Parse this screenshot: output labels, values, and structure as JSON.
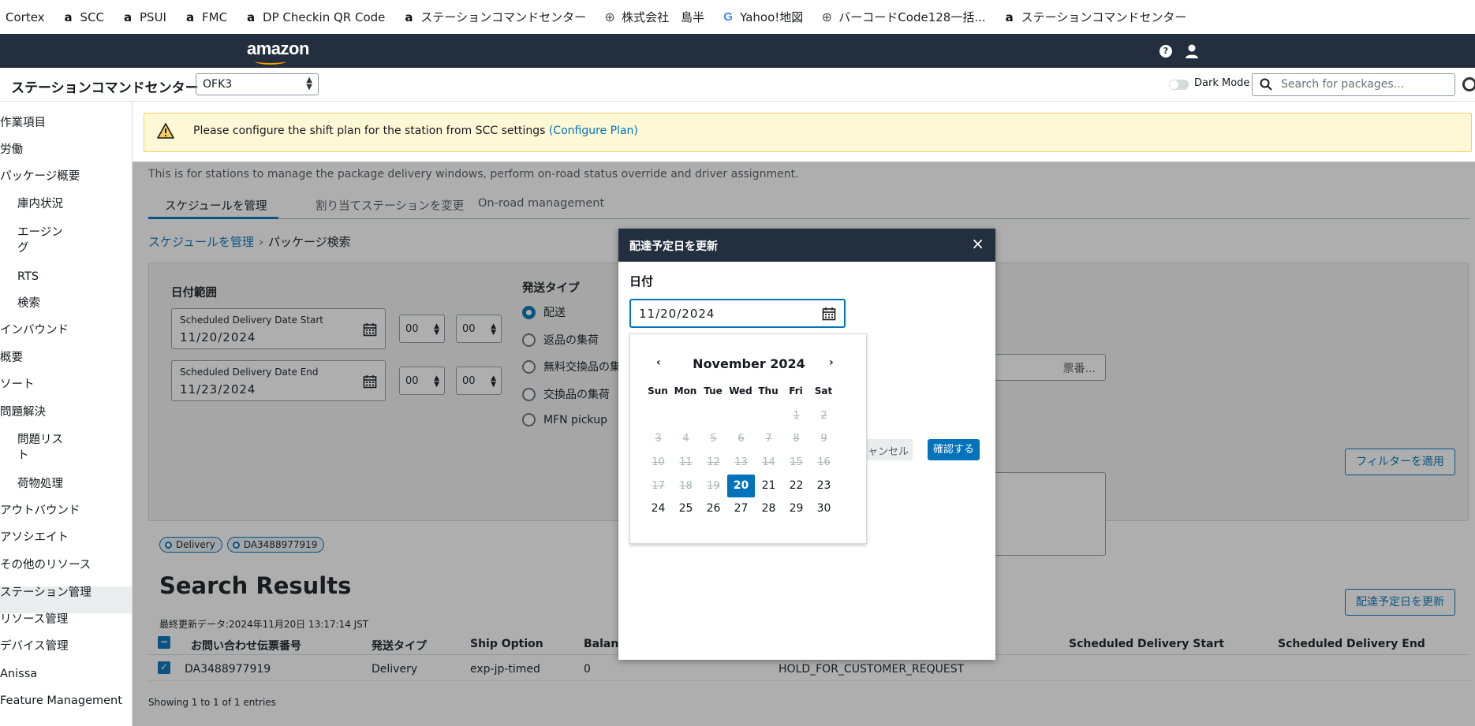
{
  "bookmarks": [
    {
      "label": "Cortex",
      "icon": "none"
    },
    {
      "label": "SCC",
      "icon": "amazon-icon"
    },
    {
      "label": "PSUI",
      "icon": "amazon-icon"
    },
    {
      "label": "FMC",
      "icon": "amazon-icon"
    },
    {
      "label": "DP Checkin QR Code",
      "icon": "amazon-icon"
    },
    {
      "label": "ステーションコマンドセンター",
      "icon": "amazon-icon"
    },
    {
      "label": "株式会社　島半",
      "icon": "globe-icon"
    },
    {
      "label": "Yahoo!地図",
      "icon": "google-icon"
    },
    {
      "label": "バーコードCode128一括...",
      "icon": "globe-icon"
    },
    {
      "label": "ステーションコマンドセンター",
      "icon": "amazon-icon"
    }
  ],
  "topbar": {
    "logo": "amazon",
    "help_icon_glyph": "?"
  },
  "header": {
    "title": "ステーションコマンドセンター",
    "station": "OFK3",
    "dark_mode_label": "Dark Mode",
    "search_placeholder": "Search for packages..."
  },
  "sidebar": {
    "items": [
      {
        "label": "作業項目",
        "sub": false
      },
      {
        "label": "労働",
        "sub": false
      },
      {
        "label": "パッケージ概要",
        "sub": false
      },
      {
        "label": "庫内状況",
        "sub": true
      },
      {
        "label": "エージン\nグ",
        "sub": true
      },
      {
        "label": "RTS",
        "sub": true
      },
      {
        "label": "検索",
        "sub": true
      },
      {
        "label": "インバウンド",
        "sub": false
      },
      {
        "label": "概要",
        "sub": false
      },
      {
        "label": "ソート",
        "sub": false
      },
      {
        "label": "問題解決",
        "sub": false
      },
      {
        "label": "問題リス\nト",
        "sub": true
      },
      {
        "label": "荷物処理",
        "sub": true
      },
      {
        "label": "アウトバウンド",
        "sub": false
      },
      {
        "label": "アソシエイト",
        "sub": false
      },
      {
        "label": "その他のリソース",
        "sub": false
      },
      {
        "label": "ステーション管理",
        "sub": false
      },
      {
        "label": "リソース管理",
        "sub": false
      },
      {
        "label": "デバイス管理",
        "sub": false
      },
      {
        "label": "Anissa",
        "sub": false
      },
      {
        "label": "Feature Management",
        "sub": false
      }
    ],
    "active": "荷物処理"
  },
  "warning": {
    "text": "Please configure the shift plan for the station from SCC settings ",
    "link": "(Configure Plan)"
  },
  "page": {
    "description": "This is for stations to manage the package delivery windows, perform on-road status override and driver assignment.",
    "tabs": [
      "スケジュールを管理",
      "割り当てステーションを変更",
      "On-road management"
    ],
    "active_tab": "スケジュールを管理",
    "breadcrumb": [
      "スケジュールを管理",
      "パッケージ検索"
    ]
  },
  "filters": {
    "date_range_label": "日付範囲",
    "start_label": "Scheduled Delivery Date Start",
    "start_value": "11/20/2024",
    "end_label": "Scheduled Delivery Date End",
    "end_value": "11/23/2024",
    "hour_start": "00",
    "minute_start": "00",
    "hour_end": "00",
    "minute_end": "00",
    "ship_type_label": "発送タイプ",
    "ship_types": [
      "配送",
      "返品の集荷",
      "無料交換品の集",
      "交換品の集荷",
      "MFN pickup"
    ],
    "ship_type_selected": "配送",
    "search_btn_partial": "票番...",
    "apply_label": "フィルターを適用"
  },
  "tokens": [
    "Delivery",
    "DA3488977919"
  ],
  "results": {
    "title": "Search Results",
    "updated": "最終更新データ:2024年11月20日 13:17:14 JST",
    "update_button": "配達予定日を更新",
    "columns": [
      "お問い合わせ伝票番号",
      "発送タイプ",
      "Ship Option",
      "Balanc",
      "Scheduled Delivery Start",
      "Scheduled Delivery End"
    ],
    "rows": [
      {
        "tracking": "DA3488977919",
        "ship_type": "Delivery",
        "ship_option": "exp-jp-timed",
        "balance": "0",
        "status": "HOLD_FOR_CUSTOMER_REQUEST"
      }
    ],
    "showing": "Showing 1 to 1 of 1 entries"
  },
  "modal": {
    "title": "配達予定日を更新",
    "field_label": "日付",
    "date_value": "11/20/2024",
    "cancel_label": "キャンセル",
    "confirm_label": "確認する"
  },
  "calendar": {
    "month_label": "November 2024",
    "prev": "‹",
    "next": "›",
    "weekdays": [
      "Sun",
      "Mon",
      "Tue",
      "Wed",
      "Thu",
      "Fri",
      "Sat"
    ],
    "first_weekday_index": 5,
    "days_in_month": 30,
    "selected_day": 20,
    "first_enabled_day": 20
  }
}
